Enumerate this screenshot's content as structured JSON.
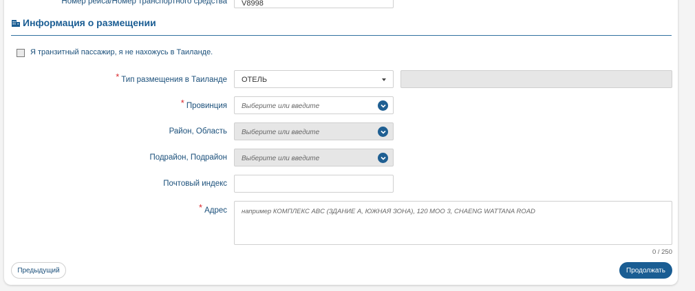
{
  "top_row": {
    "label": "Номер рейса/Номер транспортного средства",
    "value": "V8998"
  },
  "section": {
    "title": "Информация о размещении",
    "icon": "building-icon"
  },
  "transit": {
    "label": "Я транзитный пассажир, я не нахожусь в Таиланде.",
    "checked": false
  },
  "accommodation_type": {
    "label": "Тип размещения в Таиланде",
    "required": true,
    "value": "ОТЕЛЬ",
    "extra_value": ""
  },
  "province": {
    "label": "Провинция",
    "required": true,
    "placeholder": "Выберите или введите"
  },
  "district": {
    "label": "Район, Область",
    "placeholder": "Выберите или введите",
    "disabled": true
  },
  "subdistrict": {
    "label": "Подрайон, Подрайон",
    "placeholder": "Выберите или введите",
    "disabled": true
  },
  "postal": {
    "label": "Почтовый индекс",
    "value": ""
  },
  "address": {
    "label": "Адрес",
    "required": true,
    "placeholder": "например КОМПЛЕКС ABC (ЗДАНИЕ А, ЮЖНАЯ ЗОНА), 120 MOO 3, CHAENG WATTANA ROAD",
    "counter": "0 / 250"
  },
  "buttons": {
    "previous": "Предыдущий",
    "continue": "Продолжать"
  },
  "colors": {
    "primary": "#1a5d93",
    "label": "#1a4f7a",
    "required": "#d9262b",
    "disabled_bg": "#e6e6e6"
  },
  "required_mark": "*"
}
